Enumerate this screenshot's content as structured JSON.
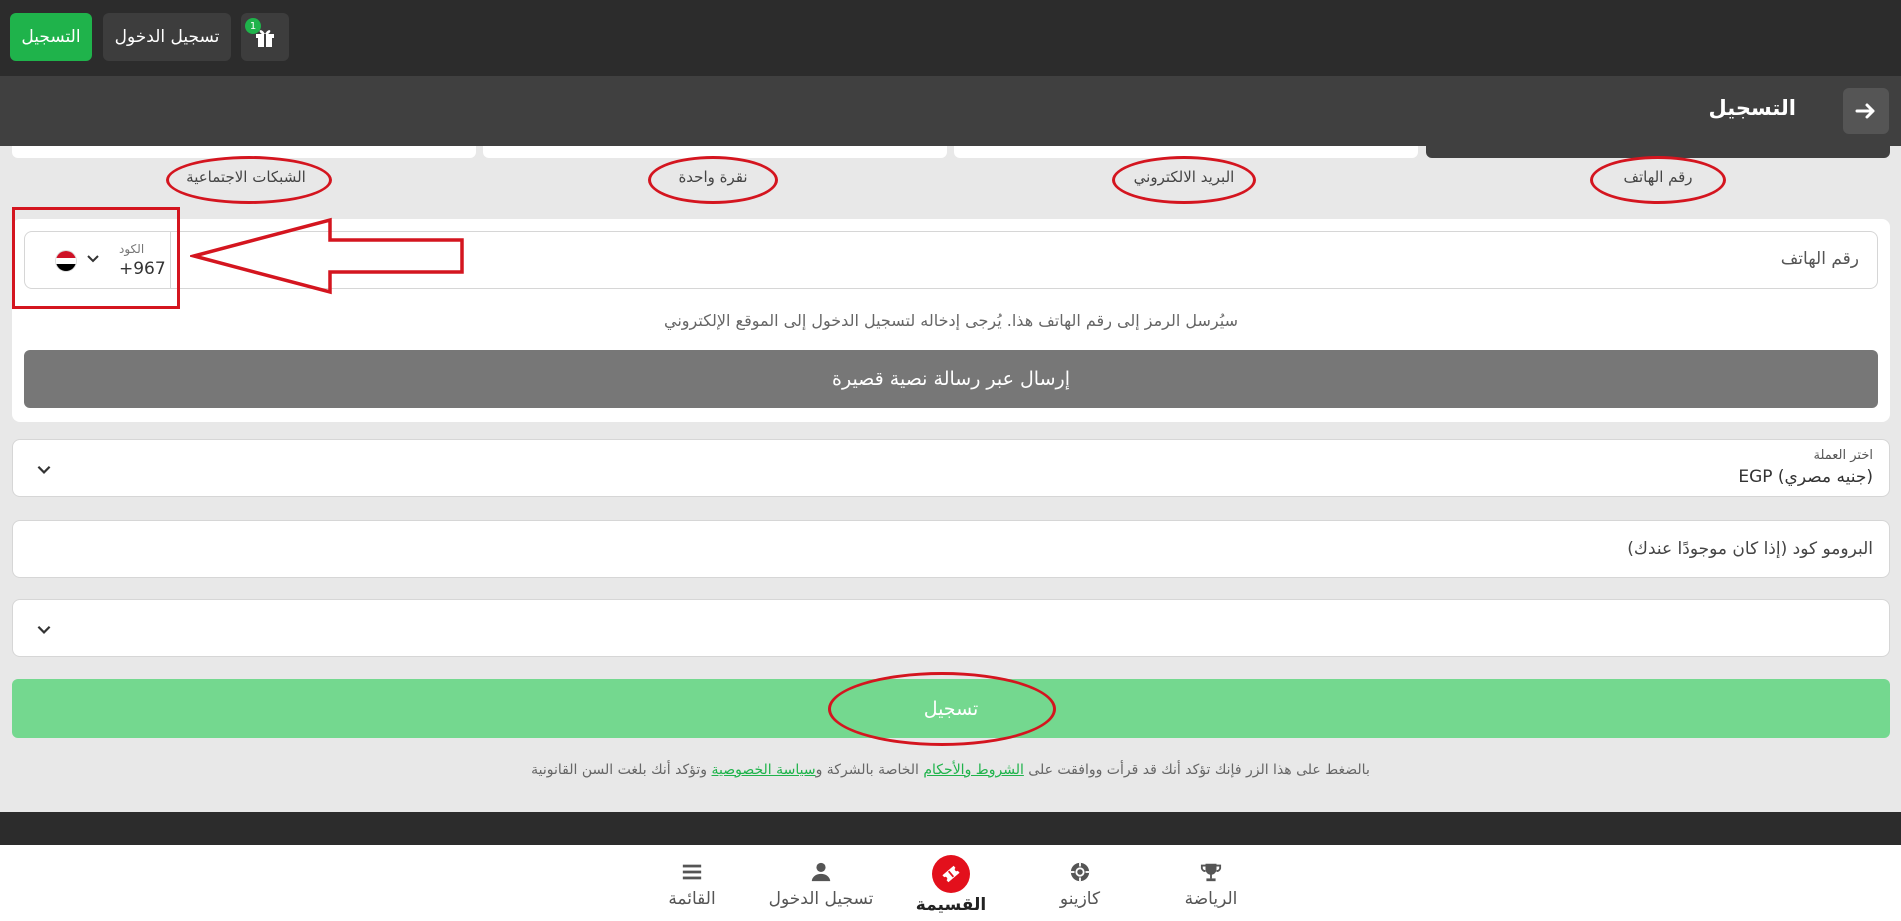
{
  "header": {
    "register_label": "التسجيل",
    "login_label": "تسجيل الدخول",
    "gift_badge_count": "1"
  },
  "titlebar": {
    "title": "التسجيل"
  },
  "tabs": [
    {
      "label": "رقم الهاتف",
      "active": true
    },
    {
      "label": "البريد الالكتروني",
      "active": false
    },
    {
      "label": "نقرة واحدة",
      "active": false
    },
    {
      "label": "الشبكات الاجتماعية",
      "active": false
    }
  ],
  "phone": {
    "placeholder": "رقم الهاتف",
    "code_label": "الكود",
    "code_value": "+967",
    "flag_colors": [
      "#ce1126",
      "#ffffff",
      "#000000"
    ],
    "hint": "سيُرسل الرمز إلى رقم الهاتف هذا. يُرجى إدخاله لتسجيل الدخول إلى الموقع الإلكتروني",
    "sms_button": "إرسال عبر رسالة نصية قصيرة"
  },
  "currency": {
    "label": "اختر العملة",
    "value": "EGP  (جنيه مصري)"
  },
  "promo": {
    "placeholder": "البرومو كود (إذا كان موجودًا عندك)"
  },
  "submit": {
    "label": "تسجيل"
  },
  "terms": {
    "prefix": "بالضغط على هذا الزر فإنك تؤكد أنك قد قرأت ووافقت على ",
    "terms_link": "الشروط والأحكام",
    "middle": " الخاصة بالشركة و",
    "privacy_link": "سياسة الخصوصية",
    "suffix": " وتؤكد أنك بلغت السن القانونية"
  },
  "bottom_nav": [
    {
      "label": "الرياضة",
      "icon": "trophy-icon"
    },
    {
      "label": "كازينو",
      "icon": "casino-chip-icon"
    },
    {
      "label": "القسيمة",
      "icon": "coupon-icon",
      "active": true
    },
    {
      "label": "تسجيل الدخول",
      "icon": "user-icon"
    },
    {
      "label": "القائمة",
      "icon": "menu-icon"
    }
  ],
  "colors": {
    "brand_green": "#1fb34b",
    "annotation_red": "#d4151f",
    "coupon_red": "#e3101c"
  }
}
